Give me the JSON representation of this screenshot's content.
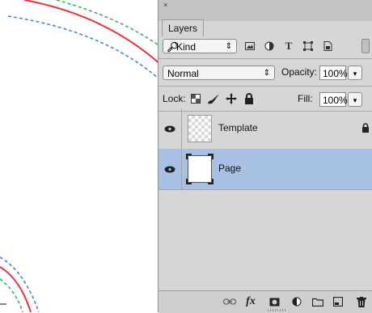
{
  "panel": {
    "close_glyph": "×",
    "tab_label": "Layers"
  },
  "filter": {
    "kind_label": "Kind",
    "icons": [
      "image-filter-icon",
      "adjustment-filter-icon",
      "type-filter-icon",
      "shape-filter-icon",
      "smart-object-filter-icon"
    ]
  },
  "blend": {
    "mode": "Normal",
    "opacity_label": "Opacity:",
    "opacity_value": "100%"
  },
  "lock": {
    "label": "Lock:",
    "fill_label": "Fill:",
    "fill_value": "100%"
  },
  "layers": [
    {
      "name": "Template",
      "visible": true,
      "locked": true,
      "selected": false
    },
    {
      "name": "Page",
      "visible": true,
      "locked": false,
      "selected": true
    }
  ],
  "bottom_icons": [
    "link-icon",
    "fx-icon",
    "mask-icon",
    "adjustment-icon",
    "folder-icon",
    "new-layer-icon",
    "trash-icon"
  ],
  "colors": {
    "selection": "#a6c1e3",
    "panel_bg": "#d6d6d6",
    "guide_red": "#e8343c",
    "guide_green": "#2fb15a",
    "guide_blue": "#3b7fd6"
  }
}
